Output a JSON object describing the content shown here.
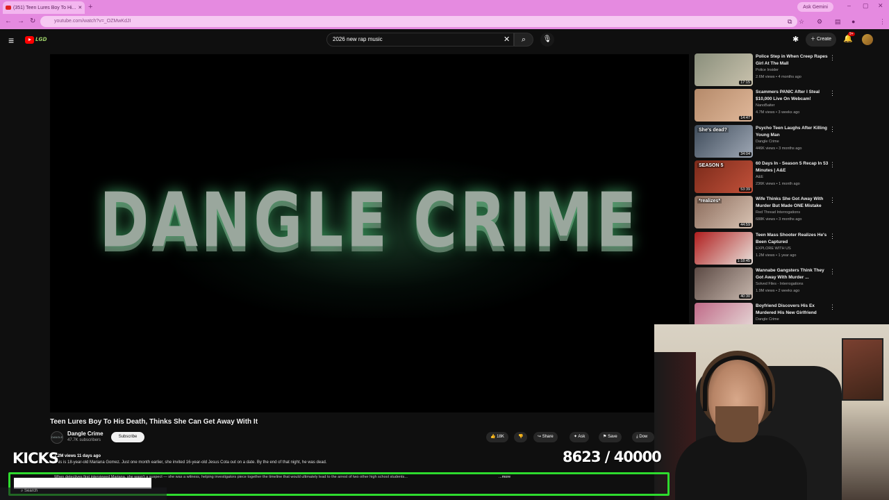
{
  "browser": {
    "tab_title": "(351) Teen Lures Boy To Hi...",
    "url": "youtube.com/watch?v=_OZMwKdJI",
    "ask_gemini": "Ask Gemini",
    "accent": "#e58ae0"
  },
  "header": {
    "search_query": "2026 new rap music",
    "create_label": "Create",
    "notification_badge": "9+"
  },
  "video": {
    "title": "Teen Lures Boy To His Death, Thinks She Can Get Away With It",
    "art_text": "DANGLE CRIME",
    "channel": "Dangle Crime",
    "subscribers": "47.7K subscribers",
    "subscribe_label": "Subscribe",
    "likes": "18K",
    "share_label": "Share",
    "ask_label": "Ask",
    "save_label": "Save",
    "download_label": "Dow",
    "views_date": "1.2M views  11 days ago",
    "desc_line1": "This is 18-year-old Mariana Gomez. Just one month earlier, she invited 16-year-old Jesus Cota out on a date. By the end of that night, he was dead.",
    "desc_line2": "When detectives first interviewed Mariana, she wasn't a suspect — she was a witness, helping investigators piece together the timeline that would ultimately lead to the arrest of two other high school students...",
    "more_label": "...more"
  },
  "recommendations": [
    {
      "title": "Police Step in When Creep Rapes Girl At The Mall",
      "channel": "Police Insider",
      "meta": "2.6M views • 4 months ago",
      "duration": "17:15",
      "thumb_text": "",
      "color_a": "#8a8f7c",
      "color_b": "#c9c2ad"
    },
    {
      "title": "Scammers PANIC After I Steal $10,000 Live On Webcam!",
      "channel": "NanoBaiter",
      "meta": "4.7M views • 3 weeks ago",
      "duration": "14:47",
      "thumb_text": "",
      "color_a": "#b58a6a",
      "color_b": "#e0b89a"
    },
    {
      "title": "Psycho Teen Laughs After Killing Young Man",
      "channel": "Dangle Crime",
      "meta": "446K views • 3 months ago",
      "duration": "34:04",
      "thumb_text": "She's dead?",
      "color_a": "#3e4b5a",
      "color_b": "#9fa8b5"
    },
    {
      "title": "60 Days In - Season 5 Recap In 53 Minutes | A&E",
      "channel": "A&E",
      "meta": "236K views • 1 month ago",
      "duration": "53:39",
      "thumb_text": "SEASON 5",
      "color_a": "#7a2a1a",
      "color_b": "#c2513a"
    },
    {
      "title": "Wife Thinks She Got Away With Murder But Made ONE Mistake",
      "channel": "Red Thread Interrogations",
      "meta": "688K views • 3 months ago",
      "duration": "44:59",
      "thumb_text": "*realizes*",
      "color_a": "#8a6a5a",
      "color_b": "#d9c4b4"
    },
    {
      "title": "Teen Mass Shooter Realizes He's Been Captured",
      "channel": "EXPLORE WITH US",
      "meta": "1.2M views • 1 year ago",
      "duration": "1:18:45",
      "thumb_text": "",
      "color_a": "#b01e1e",
      "color_b": "#e9e2dc"
    },
    {
      "title": "Wannabe Gangsters Think They Got Away With Murder ...",
      "channel": "Solved Files - Interrogations",
      "meta": "1.9M views • 2 weeks ago",
      "duration": "40:30",
      "thumb_text": "",
      "color_a": "#5c4a44",
      "color_b": "#c7b7ad"
    },
    {
      "title": "Boyfriend Discovers His Ex Murdered His New Girlfriend",
      "channel": "Dangle Crime",
      "meta": "",
      "duration": "",
      "thumb_text": "",
      "color_a": "#c06a88",
      "color_b": "#e8e0dc"
    }
  ],
  "overlay": {
    "kicks_label": "KICKS",
    "count_current": "8623",
    "count_goal": "40000",
    "counter_text": "8623  / 40000",
    "goal_color": "#2edb2e"
  },
  "taskbar": {
    "search_label": "Search"
  }
}
